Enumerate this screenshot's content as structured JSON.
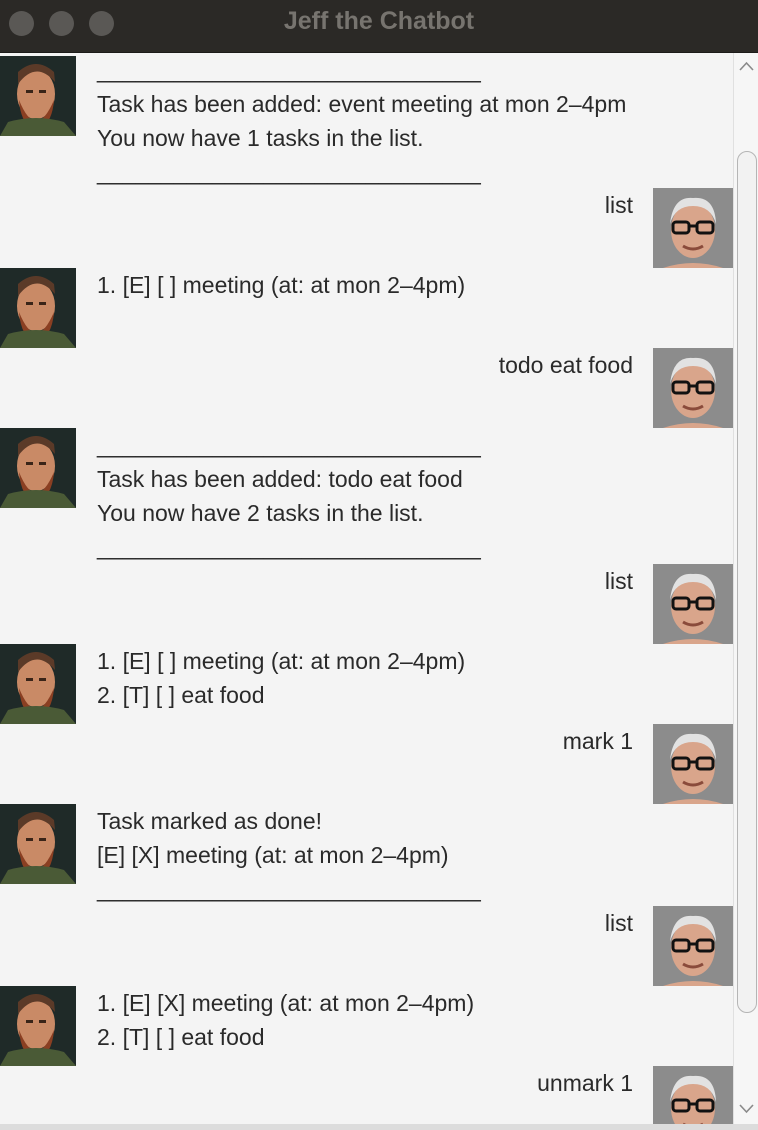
{
  "window": {
    "title": "Jeff the Chatbot"
  },
  "messages": [
    {
      "from": "bot",
      "lines": [
        "______________________________",
        "Task has been added: event meeting at mon 2–4pm",
        "You now have 1 tasks in the list.",
        "______________________________"
      ]
    },
    {
      "from": "user",
      "lines": [
        "list"
      ]
    },
    {
      "from": "bot",
      "lines": [
        "1. [E] [ ] meeting (at: at mon 2–4pm)"
      ]
    },
    {
      "from": "user",
      "lines": [
        "todo eat food"
      ]
    },
    {
      "from": "bot",
      "lines": [
        "______________________________",
        "Task has been added: todo eat food",
        "You now have 2 tasks in the list.",
        "______________________________"
      ]
    },
    {
      "from": "user",
      "lines": [
        "list"
      ]
    },
    {
      "from": "bot",
      "lines": [
        "1. [E] [ ] meeting (at: at mon 2–4pm)",
        "2. [T] [ ] eat food"
      ]
    },
    {
      "from": "user",
      "lines": [
        "mark 1"
      ]
    },
    {
      "from": "bot",
      "lines": [
        "Task marked as done!",
        "[E] [X] meeting (at: at mon 2–4pm)",
        "______________________________"
      ]
    },
    {
      "from": "user",
      "lines": [
        "list"
      ]
    },
    {
      "from": "bot",
      "lines": [
        "1. [E] [X] meeting (at: at mon 2–4pm)",
        "2. [T] [ ] eat food"
      ]
    },
    {
      "from": "user",
      "lines": [
        "unmark 1"
      ]
    }
  ],
  "icons": {
    "bot_avatar": "bot-avatar-icon",
    "user_avatar": "user-avatar-icon",
    "scroll_up": "chevron-up-icon",
    "scroll_down": "chevron-down-icon"
  }
}
